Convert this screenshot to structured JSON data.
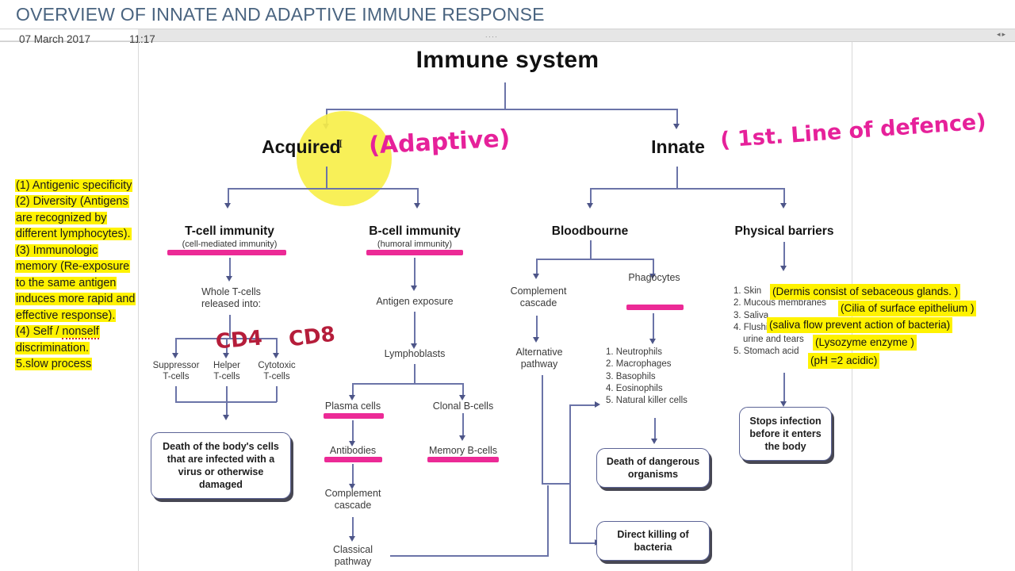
{
  "header": {
    "title": "OVERVIEW OF INNATE AND ADAPTIVE IMMUNE RESPONSE",
    "date": "07 March 2017",
    "time": "11:17",
    "ruler_dots": "....",
    "ruler_arrows": "◂▸"
  },
  "diagram": {
    "root": "Immune system",
    "branch_left": "Acquired",
    "branch_right": "Innate",
    "tcell": {
      "title": "T-cell immunity",
      "subtitle": "(cell-mediated immunity)",
      "whole": "Whole T-cells\nreleased into:",
      "suppressor": "Suppressor\nT-cells",
      "helper": "Helper\nT-cells",
      "cytotoxic": "Cytotoxic\nT-cells",
      "death_box": "Death of the body's cells that are infected with a virus or otherwise damaged"
    },
    "bcell": {
      "title": "B-cell immunity",
      "subtitle": "(humoral immunity)",
      "antigen_exposure": "Antigen exposure",
      "lymphoblasts": "Lymphoblasts",
      "plasma_cells": "Plasma cells",
      "clonal_bcells": "Clonal B-cells",
      "antibodies": "Antibodies",
      "memory_bcells": "Memory B-cells",
      "complement_cascade": "Complement\ncascade",
      "classical_pathway": "Classical\npathway"
    },
    "bloodbourne": {
      "title": "Bloodbourne",
      "complement_cascade": "Complement\ncascade",
      "alternative_pathway": "Alternative\npathway",
      "phagocytes": "Phagocytes",
      "phagocyte_list": [
        "1. Neutrophils",
        "2. Macrophages",
        "3. Basophils",
        "4. Eosinophils",
        "5. Natural killer cells"
      ],
      "death_box": "Death of dangerous organisms",
      "direct_kill_box": "Direct killing of bacteria"
    },
    "physical": {
      "title": "Physical barriers",
      "items": [
        "1. Skin",
        "2. Mucous membranes",
        "3. Saliva",
        "4. Flushing action",
        "urine and tears",
        "5. Stomach acid"
      ],
      "stops_box": "Stops infection before it enters the body"
    }
  },
  "annotations": {
    "handwritten_adaptive": "(Adaptive)",
    "handwritten_defence": "( 1st. Line of defence)",
    "handwritten_cd4": "CD4",
    "handwritten_cd8": "CD8",
    "yellow_notes": [
      "(1) Antigenic specificity",
      "(2) Diversity (Antigens are recognized by different lymphocytes).",
      "(3) Immunologic memory (Re-exposure to the same antigen induces more rapid and effective response).",
      "(4) Self / nonself discrimination.",
      "5.slow process"
    ],
    "notes_line_1": "(1) Antigenic specificity",
    "notes_line_2a": "(2) Diversity (Antigens",
    "notes_line_2b": "are recognized by",
    "notes_line_2c": "different lymphocytes).",
    "notes_line_3a": "(3) Immunologic",
    "notes_line_3b": "memory (Re-exposure",
    "notes_line_3c": "to the same antigen",
    "notes_line_3d": "induces more rapid and",
    "notes_line_3e": "effective response).",
    "notes_line_4a": "(4) Self / ",
    "notes_line_4b": "nonself",
    "notes_line_4c": "discrimination.",
    "notes_line_5": "5.slow process",
    "physical_notes": [
      "(Dermis consist of sebaceous glands. )",
      "(Cilia of surface epithelium )",
      "(saliva flow prevent action of bacteria)",
      "(Lysozyme enzyme )",
      "(pH =2 acidic)"
    ]
  },
  "colors": {
    "title_blue": "#4a6480",
    "connector": "#6b74a8",
    "pink_highlight": "#ec2a96",
    "yellow_highlight": "#fff200",
    "yellow_blob": "#f7ef4a",
    "hand_pink": "#e6219a",
    "hand_red": "#b51d3a"
  }
}
